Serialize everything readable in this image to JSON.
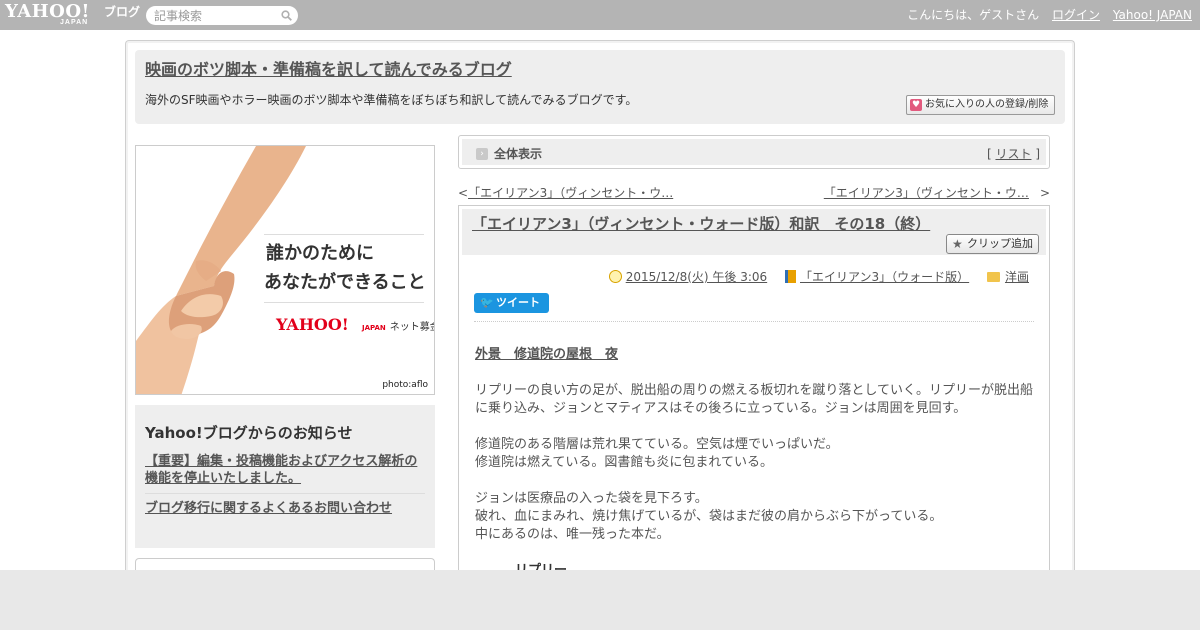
{
  "topbar": {
    "logo_text": "YAHOO!",
    "logo_sub": "JAPAN",
    "logo_blog": "ブログ",
    "search_placeholder": "記事検索",
    "greeting": "こんにちは、ゲストさん",
    "login": "ログイン",
    "yahoo_japan": "Yahoo! JAPAN"
  },
  "header": {
    "title": "映画のボツ脚本・準備稿を訳して読んでみるブログ",
    "description": "海外のSF映画やホラー映画のボツ脚本や準備稿をぼちぼち和訳して読んでみるブログです。",
    "fav_button": "お気に入りの人の登録/削除"
  },
  "ad": {
    "line1": "誰かのために",
    "line2": "あなたができること",
    "brand": "YAHOO!",
    "brand_sub": "JAPAN",
    "brand_label": "ネット募金",
    "credit": "photo:aflo"
  },
  "notice": {
    "heading": "Yahoo!ブログからのお知らせ",
    "items": [
      "【重要】編集・投稿機能およびアクセス解析の機能を停止いたしました。",
      "ブログ移行に関するよくあるお問い合わせ"
    ]
  },
  "view_bar": {
    "label": "全体表示",
    "list_open": "[",
    "list_label": "リスト",
    "list_close": "]"
  },
  "pager": {
    "prev_arrow": "<",
    "prev_label": "「エイリアン3」（ヴィンセント・ウ…",
    "next_label": "「エイリアン3」（ヴィンセント・ウ…",
    "next_arrow": ">"
  },
  "article": {
    "title": "「エイリアン3」（ヴィンセント・ウォード版）和訳　その18（終）",
    "clip_button": "クリップ追加",
    "date": "2015/12/8(火) 午後 3:06",
    "book": "「エイリアン3」（ウォード版）",
    "category": "洋画",
    "tweet": "ツイート",
    "scene": "外景　修道院の屋根　夜",
    "paragraphs": [
      "リプリーの良い方の足が、脱出船の周りの燃える板切れを蹴り落としていく。リプリーが脱出船に乗り込み、ジョンとマティアスはその後ろに立っている。ジョンは周囲を見回す。",
      "修道院のある階層は荒れ果てている。空気は煙でいっぱいだ。\n修道院は燃えている。図書館も炎に包まれている。",
      "ジョンは医療品の入った袋を見下ろす。\n破れ、血にまみれ、焼け焦げているが、袋はまだ彼の肩からぶら下がっている。\n中にあるのは、唯一残った本だ。"
    ],
    "speaker": "リプリー"
  },
  "colors": {
    "topbar": "#b4b4b4",
    "panel": "#eeeeee",
    "tweet": "#1b95e0",
    "link": "#555555"
  }
}
